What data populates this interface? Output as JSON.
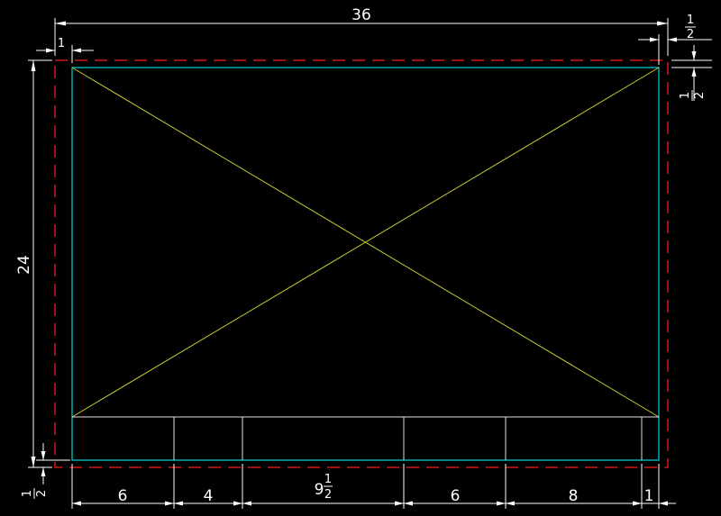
{
  "colors": {
    "background": "#000000",
    "sheet_border": "#00c8c8",
    "cut_line": "#d01818",
    "diagonals": "#c8c832",
    "dimension": "#ffffff"
  },
  "dimensions": {
    "overall_width": "36",
    "overall_height": "24",
    "left_margin": "1",
    "right_margin_num": "1",
    "right_margin_den": "2",
    "top_margin_num": "1",
    "top_margin_den": "2",
    "bottom_margin_num": "1",
    "bottom_margin_den": "2",
    "title_block": {
      "seg1": "6",
      "seg2": "4",
      "seg3_whole": "9",
      "seg3_num": "1",
      "seg3_den": "2",
      "seg4": "6",
      "seg5": "8",
      "seg6": "1"
    }
  }
}
